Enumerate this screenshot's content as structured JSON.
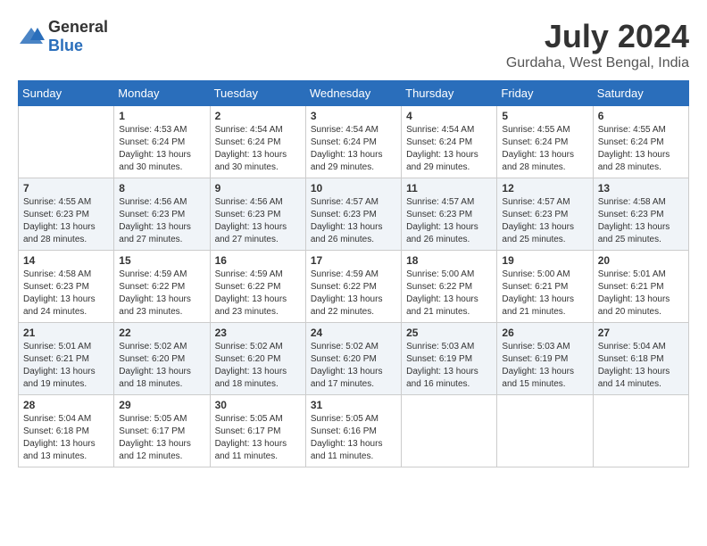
{
  "logo": {
    "general": "General",
    "blue": "Blue"
  },
  "header": {
    "month_year": "July 2024",
    "location": "Gurdaha, West Bengal, India"
  },
  "weekdays": [
    "Sunday",
    "Monday",
    "Tuesday",
    "Wednesday",
    "Thursday",
    "Friday",
    "Saturday"
  ],
  "weeks": [
    [
      {
        "day": "",
        "info": ""
      },
      {
        "day": "1",
        "info": "Sunrise: 4:53 AM\nSunset: 6:24 PM\nDaylight: 13 hours\nand 30 minutes."
      },
      {
        "day": "2",
        "info": "Sunrise: 4:54 AM\nSunset: 6:24 PM\nDaylight: 13 hours\nand 30 minutes."
      },
      {
        "day": "3",
        "info": "Sunrise: 4:54 AM\nSunset: 6:24 PM\nDaylight: 13 hours\nand 29 minutes."
      },
      {
        "day": "4",
        "info": "Sunrise: 4:54 AM\nSunset: 6:24 PM\nDaylight: 13 hours\nand 29 minutes."
      },
      {
        "day": "5",
        "info": "Sunrise: 4:55 AM\nSunset: 6:24 PM\nDaylight: 13 hours\nand 28 minutes."
      },
      {
        "day": "6",
        "info": "Sunrise: 4:55 AM\nSunset: 6:24 PM\nDaylight: 13 hours\nand 28 minutes."
      }
    ],
    [
      {
        "day": "7",
        "info": "Sunrise: 4:55 AM\nSunset: 6:23 PM\nDaylight: 13 hours\nand 28 minutes."
      },
      {
        "day": "8",
        "info": "Sunrise: 4:56 AM\nSunset: 6:23 PM\nDaylight: 13 hours\nand 27 minutes."
      },
      {
        "day": "9",
        "info": "Sunrise: 4:56 AM\nSunset: 6:23 PM\nDaylight: 13 hours\nand 27 minutes."
      },
      {
        "day": "10",
        "info": "Sunrise: 4:57 AM\nSunset: 6:23 PM\nDaylight: 13 hours\nand 26 minutes."
      },
      {
        "day": "11",
        "info": "Sunrise: 4:57 AM\nSunset: 6:23 PM\nDaylight: 13 hours\nand 26 minutes."
      },
      {
        "day": "12",
        "info": "Sunrise: 4:57 AM\nSunset: 6:23 PM\nDaylight: 13 hours\nand 25 minutes."
      },
      {
        "day": "13",
        "info": "Sunrise: 4:58 AM\nSunset: 6:23 PM\nDaylight: 13 hours\nand 25 minutes."
      }
    ],
    [
      {
        "day": "14",
        "info": "Sunrise: 4:58 AM\nSunset: 6:23 PM\nDaylight: 13 hours\nand 24 minutes."
      },
      {
        "day": "15",
        "info": "Sunrise: 4:59 AM\nSunset: 6:22 PM\nDaylight: 13 hours\nand 23 minutes."
      },
      {
        "day": "16",
        "info": "Sunrise: 4:59 AM\nSunset: 6:22 PM\nDaylight: 13 hours\nand 23 minutes."
      },
      {
        "day": "17",
        "info": "Sunrise: 4:59 AM\nSunset: 6:22 PM\nDaylight: 13 hours\nand 22 minutes."
      },
      {
        "day": "18",
        "info": "Sunrise: 5:00 AM\nSunset: 6:22 PM\nDaylight: 13 hours\nand 21 minutes."
      },
      {
        "day": "19",
        "info": "Sunrise: 5:00 AM\nSunset: 6:21 PM\nDaylight: 13 hours\nand 21 minutes."
      },
      {
        "day": "20",
        "info": "Sunrise: 5:01 AM\nSunset: 6:21 PM\nDaylight: 13 hours\nand 20 minutes."
      }
    ],
    [
      {
        "day": "21",
        "info": "Sunrise: 5:01 AM\nSunset: 6:21 PM\nDaylight: 13 hours\nand 19 minutes."
      },
      {
        "day": "22",
        "info": "Sunrise: 5:02 AM\nSunset: 6:20 PM\nDaylight: 13 hours\nand 18 minutes."
      },
      {
        "day": "23",
        "info": "Sunrise: 5:02 AM\nSunset: 6:20 PM\nDaylight: 13 hours\nand 18 minutes."
      },
      {
        "day": "24",
        "info": "Sunrise: 5:02 AM\nSunset: 6:20 PM\nDaylight: 13 hours\nand 17 minutes."
      },
      {
        "day": "25",
        "info": "Sunrise: 5:03 AM\nSunset: 6:19 PM\nDaylight: 13 hours\nand 16 minutes."
      },
      {
        "day": "26",
        "info": "Sunrise: 5:03 AM\nSunset: 6:19 PM\nDaylight: 13 hours\nand 15 minutes."
      },
      {
        "day": "27",
        "info": "Sunrise: 5:04 AM\nSunset: 6:18 PM\nDaylight: 13 hours\nand 14 minutes."
      }
    ],
    [
      {
        "day": "28",
        "info": "Sunrise: 5:04 AM\nSunset: 6:18 PM\nDaylight: 13 hours\nand 13 minutes."
      },
      {
        "day": "29",
        "info": "Sunrise: 5:05 AM\nSunset: 6:17 PM\nDaylight: 13 hours\nand 12 minutes."
      },
      {
        "day": "30",
        "info": "Sunrise: 5:05 AM\nSunset: 6:17 PM\nDaylight: 13 hours\nand 11 minutes."
      },
      {
        "day": "31",
        "info": "Sunrise: 5:05 AM\nSunset: 6:16 PM\nDaylight: 13 hours\nand 11 minutes."
      },
      {
        "day": "",
        "info": ""
      },
      {
        "day": "",
        "info": ""
      },
      {
        "day": "",
        "info": ""
      }
    ]
  ]
}
